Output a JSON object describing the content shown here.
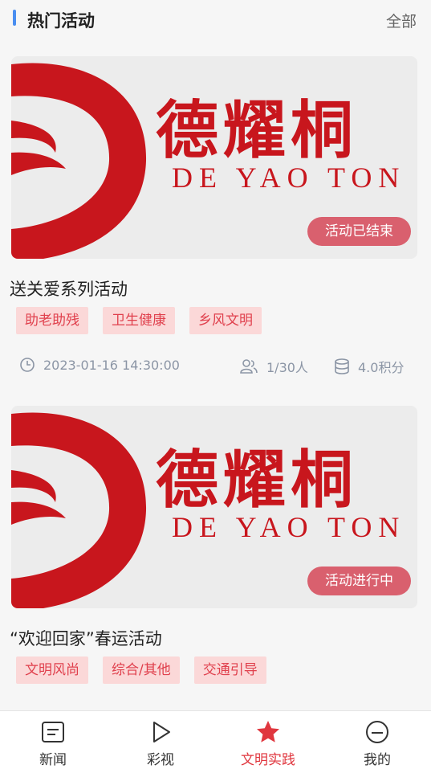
{
  "header": {
    "title": "热门活动",
    "all_label": "全部"
  },
  "activities": [
    {
      "brand_cn": "德耀桐",
      "brand_en": "DE YAO TON",
      "status": "活动已结束",
      "title": "送关爱系列活动",
      "tags": [
        "助老助残",
        "卫生健康",
        "乡风文明"
      ],
      "datetime": "2023-01-16 14:30:00",
      "participants": "1/30人",
      "points": "4.0积分"
    },
    {
      "brand_cn": "德耀桐",
      "brand_en": "DE YAO TON",
      "status": "活动进行中",
      "title": "“欢迎回家”春运活动",
      "tags": [
        "文明风尚",
        "综合/其他",
        "交通引导"
      ]
    }
  ],
  "tabbar": {
    "items": [
      {
        "label": "新闻",
        "icon": "news-icon"
      },
      {
        "label": "彩视",
        "icon": "play-icon"
      },
      {
        "label": "文明实践",
        "icon": "star-icon",
        "active": true
      },
      {
        "label": "我的",
        "icon": "profile-icon"
      }
    ]
  },
  "colors": {
    "accent": "#e0373f",
    "brand_red": "#c8161d",
    "tag_bg": "#fbd8d8",
    "status_bg": "#d9606e"
  }
}
